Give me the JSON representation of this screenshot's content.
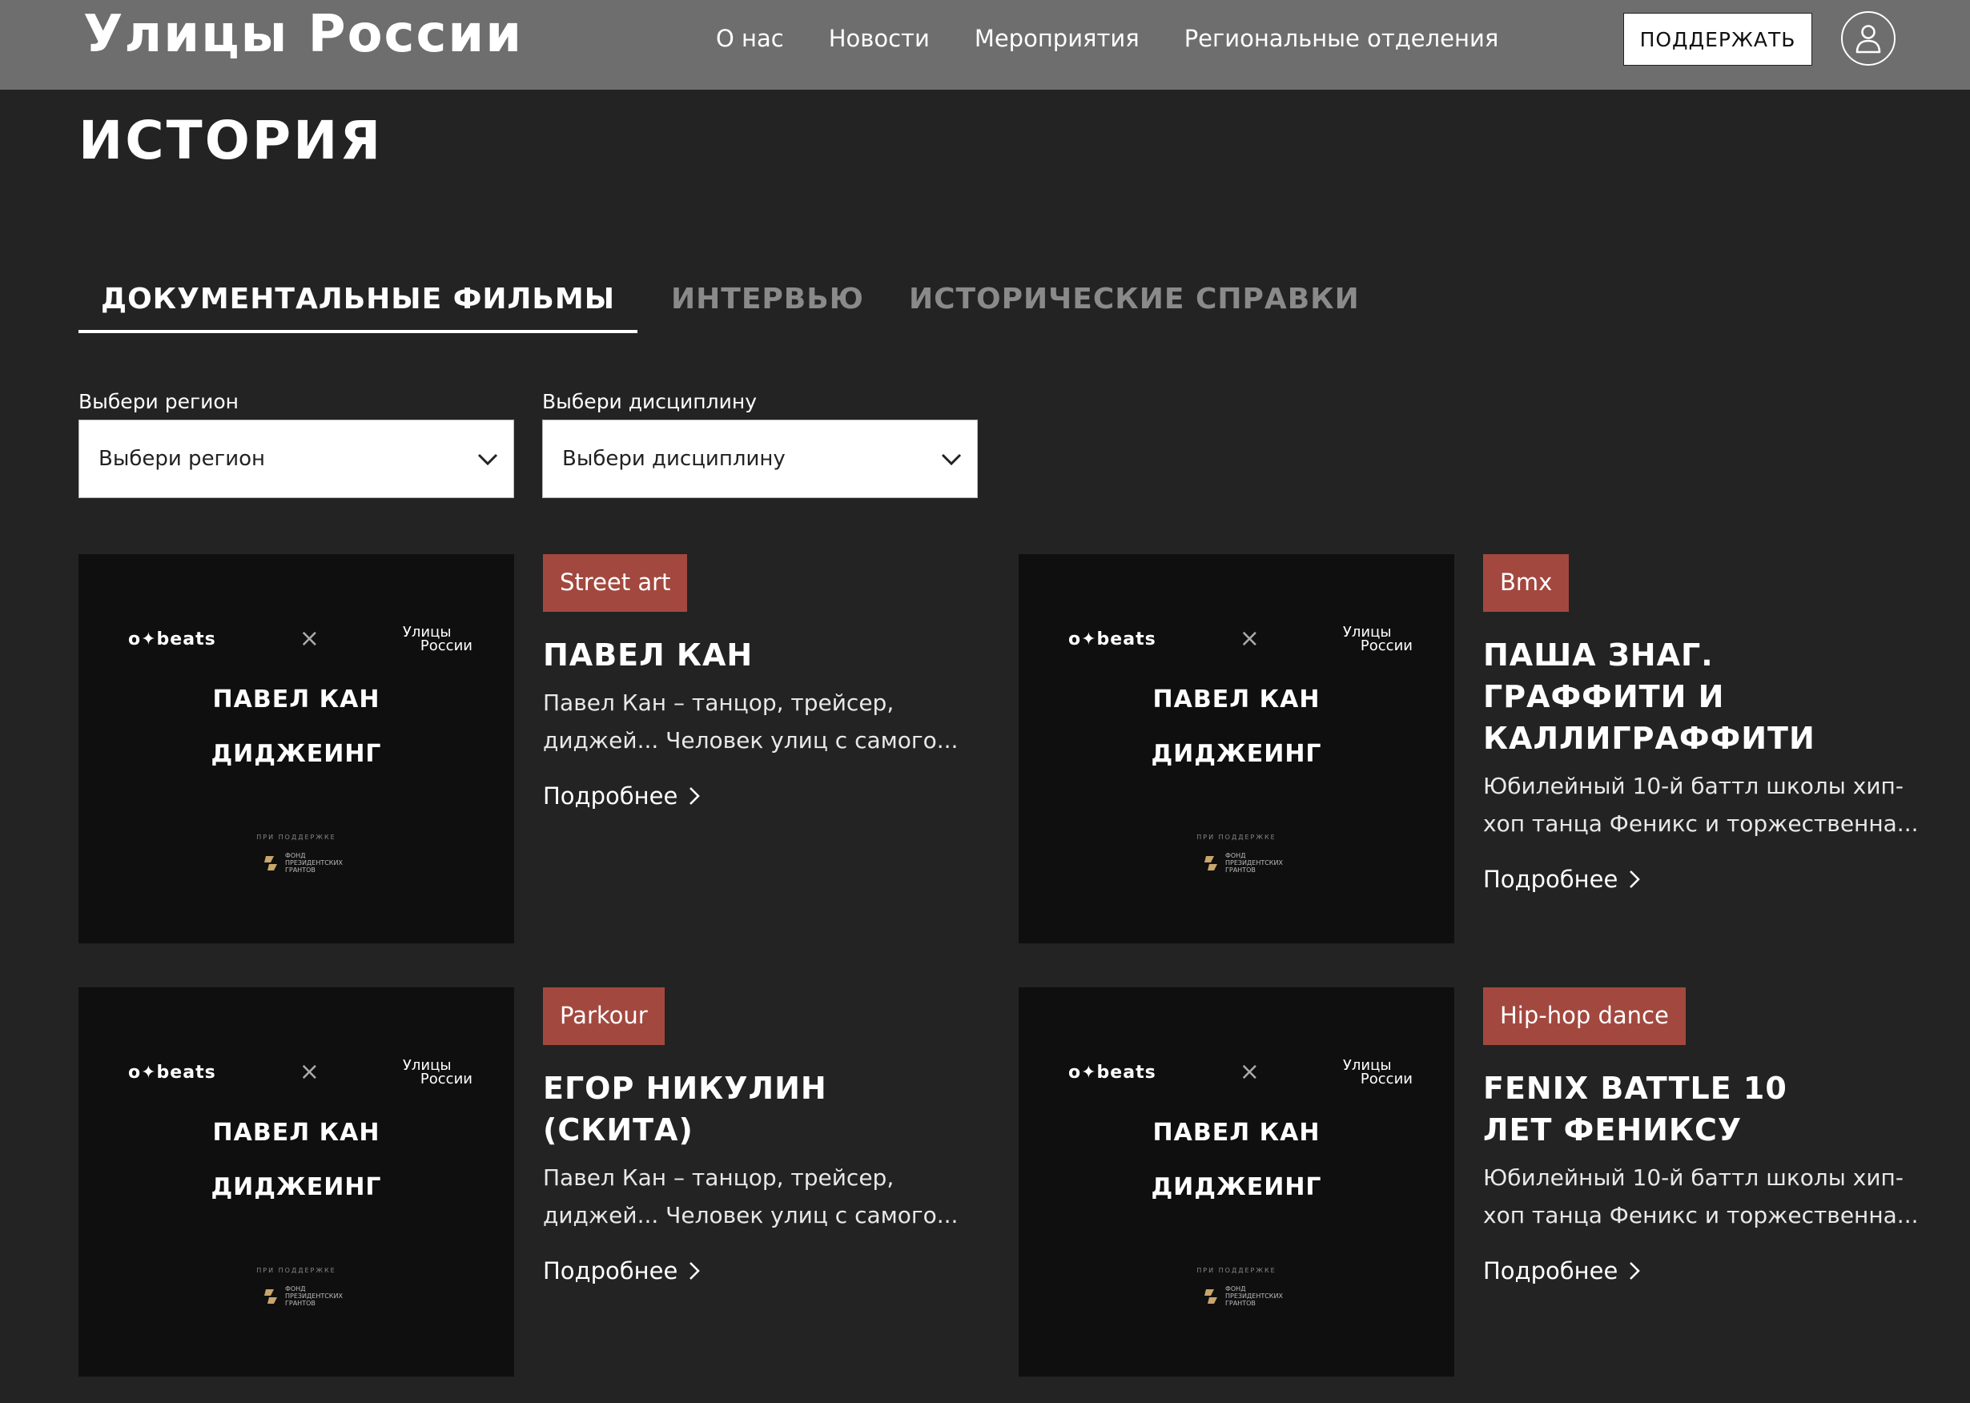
{
  "header": {
    "logo": "Улицы России",
    "nav": [
      "О нас",
      "Новости",
      "Мероприятия",
      "Региональные отделения"
    ],
    "support_label": "ПОДДЕРЖАТЬ",
    "user_icon": "user-icon"
  },
  "page": {
    "title": "ИСТОРИЯ"
  },
  "tabs": [
    "ДОКУМЕНТАЛЬНЫЕ ФИЛЬМЫ",
    "ИНТЕРВЬЮ",
    "ИСТОРИЧЕСКИЕ СПРАВКИ"
  ],
  "active_tab": 0,
  "filters": {
    "region": {
      "label": "Выбери регион",
      "value": "Выбери регион"
    },
    "discipline": {
      "label": "Выбери дисциплину",
      "value": "Выбери дисциплину"
    }
  },
  "thumbnail": {
    "brand_left": "o✦beats",
    "separator": "×",
    "brand_right_line1": "Улицы",
    "brand_right_line2": "России",
    "title_line1": "ПАВЕЛ КАН",
    "title_line2": "ДИДЖЕИНГ",
    "support_text": "ПРИ ПОДДЕРЖКЕ",
    "fund_text": "ФОНД\nПРЕЗИДЕНТСКИХ\nГРАНТОВ"
  },
  "colors": {
    "badge": "#a3483f",
    "background": "#232323",
    "header": "#6e6e6e"
  },
  "more_label": "Подробнее",
  "cards": [
    {
      "tag": "Street art",
      "title_lines": [
        "ПАВЕЛ КАН"
      ],
      "desc_lines": [
        "Павел Кан – танцор, трейсер,",
        "диджей... Человек улиц с самого..."
      ]
    },
    {
      "tag": "Bmx",
      "title_lines": [
        "ПАША ЗНАГ.",
        "ГРАФФИТИ И",
        "КАЛЛИГРАФФИТИ"
      ],
      "desc_lines": [
        "Юбилейный 10-й баттл школы хип-",
        "хоп танца Феникс и торжественна..."
      ]
    },
    {
      "tag": "Parkour",
      "title_lines": [
        "ЕГОР НИКУЛИН",
        "(СКИТА)"
      ],
      "desc_lines": [
        "Павел Кан – танцор, трейсер,",
        "диджей... Человек улиц с самого..."
      ]
    },
    {
      "tag": "Hip-hop dance",
      "title_lines": [
        "FENIX BATTLE 10",
        "ЛЕТ ФЕНИКСУ"
      ],
      "desc_lines": [
        "Юбилейный 10-й баттл школы хип-",
        "хоп танца Феникс и торжественна..."
      ]
    }
  ]
}
